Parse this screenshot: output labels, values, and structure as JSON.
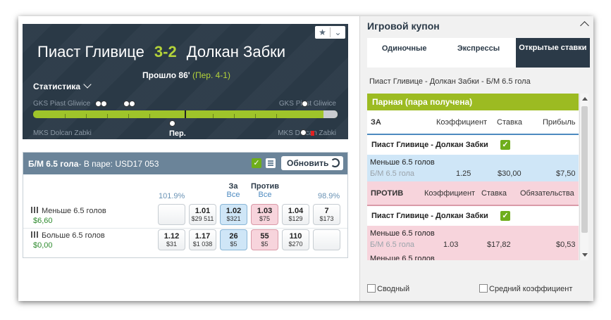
{
  "match": {
    "home": "Пиаст Гливице",
    "score": "3-2",
    "away": "Долкан Забки",
    "passed_label": "Прошло 86'",
    "period": "(Пер. 4-1)",
    "stats_label": "Статистика",
    "home_timeline_label": "GKS Piast Gliwice",
    "away_timeline_label": "MKS Dolcan Zabki",
    "half_label": "Пер.",
    "icons": [
      "star-icon",
      "chevron-down-icon",
      "ball-icon",
      "red-card-icon"
    ],
    "timeline_progress_pct": 95
  },
  "market": {
    "title": "Б/М 6.5 гола",
    "pair_info": " - В паре: USD17 053",
    "refresh_label": "Обновить",
    "back_pct": "101.9%",
    "lay_pct": "98.9%",
    "back_label": "За",
    "back_all": "Все",
    "lay_label": "Против",
    "lay_all": "Все",
    "rows": [
      {
        "name": "Меньше 6.5 голов",
        "amount": "$6,60",
        "odds": [
          {
            "price": "",
            "size": ""
          },
          {
            "price": "1.01",
            "size": "$29 511"
          },
          {
            "price": "1.02",
            "size": "$321"
          },
          {
            "price": "1.03",
            "size": "$75"
          },
          {
            "price": "1.04",
            "size": "$129"
          },
          {
            "price": "7",
            "size": "$173"
          }
        ]
      },
      {
        "name": "Больше 6.5 голов",
        "amount": "$0,00",
        "odds": [
          {
            "price": "1.12",
            "size": "$31"
          },
          {
            "price": "1.17",
            "size": "$1 038"
          },
          {
            "price": "26",
            "size": "$5"
          },
          {
            "price": "55",
            "size": "$5"
          },
          {
            "price": "110",
            "size": "$270"
          },
          {
            "price": "",
            "size": ""
          }
        ]
      }
    ]
  },
  "coupon": {
    "title": "Игровой купон",
    "tabs": [
      "Одиночные",
      "Экспрессы",
      "Открытые ставки"
    ],
    "event_line": "Пиаст Гливице - Долкан Забки - Б/М 6.5 гола",
    "pair_banner": "Парная (пара получена)",
    "back_section": {
      "label": "ЗА",
      "cols": [
        "Коэффициент",
        "Ставка",
        "Прибыль"
      ],
      "event": "Пиаст Гливице - Долкан Забки",
      "bet": {
        "selection": "Меньше 6.5 голов",
        "market": "Б/М 6.5 гола",
        "odds": "1.25",
        "stake": "$30,00",
        "profit": "$7,50"
      }
    },
    "lay_section": {
      "label": "ПРОТИВ",
      "cols": [
        "Коэффициент",
        "Ставка",
        "Обязательства"
      ],
      "event": "Пиаст Гливице - Долкан Забки",
      "bet": {
        "selection": "Меньше 6.5 голов",
        "market": "Б/М 6.5 гола",
        "odds": "1.03",
        "stake": "$17,82",
        "liability": "$0,53"
      },
      "bet2_selection": "Меньше 6.5 голов"
    },
    "footer": {
      "summary_label": "Сводный",
      "avg_odds_label": "Средний коэффициент"
    }
  }
}
